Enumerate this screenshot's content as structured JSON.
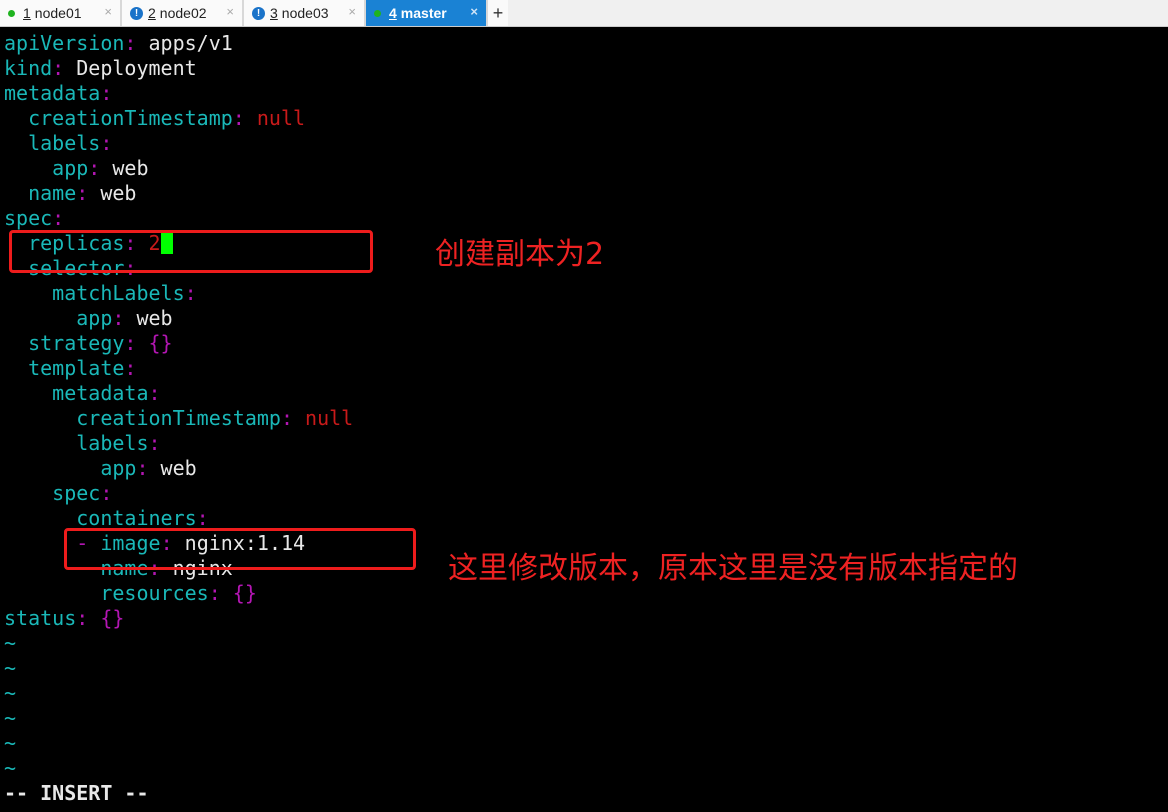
{
  "tabs": [
    {
      "num": "1",
      "label": "node01",
      "status": "connected"
    },
    {
      "num": "2",
      "label": "node02",
      "status": "warning"
    },
    {
      "num": "3",
      "label": "node03",
      "status": "warning"
    },
    {
      "num": "4",
      "label": "master",
      "status": "connected",
      "active": true
    }
  ],
  "new_tab": "+",
  "lines": [
    [
      [
        "k",
        "apiVersion"
      ],
      [
        "c",
        ":"
      ],
      [
        "v",
        " apps/v1"
      ]
    ],
    [
      [
        "k",
        "kind"
      ],
      [
        "c",
        ":"
      ],
      [
        "v",
        " Deployment"
      ]
    ],
    [
      [
        "k",
        "metadata"
      ],
      [
        "c",
        ":"
      ]
    ],
    [
      [
        "v",
        "  "
      ],
      [
        "k",
        "creationTimestamp"
      ],
      [
        "c",
        ":"
      ],
      [
        "n",
        " null"
      ]
    ],
    [
      [
        "v",
        "  "
      ],
      [
        "k",
        "labels"
      ],
      [
        "c",
        ":"
      ]
    ],
    [
      [
        "v",
        "    "
      ],
      [
        "k",
        "app"
      ],
      [
        "c",
        ":"
      ],
      [
        "v",
        " web"
      ]
    ],
    [
      [
        "v",
        "  "
      ],
      [
        "k",
        "name"
      ],
      [
        "c",
        ":"
      ],
      [
        "v",
        " web"
      ]
    ],
    [
      [
        "k",
        "spec"
      ],
      [
        "c",
        ":"
      ]
    ],
    [
      [
        "v",
        "  "
      ],
      [
        "k",
        "replicas"
      ],
      [
        "c",
        ":"
      ],
      [
        "n",
        " 2"
      ],
      [
        "cursor",
        ""
      ]
    ],
    [
      [
        "v",
        "  "
      ],
      [
        "k",
        "selector"
      ],
      [
        "c",
        ":"
      ]
    ],
    [
      [
        "v",
        "    "
      ],
      [
        "k",
        "matchLabels"
      ],
      [
        "c",
        ":"
      ]
    ],
    [
      [
        "v",
        "      "
      ],
      [
        "k",
        "app"
      ],
      [
        "c",
        ":"
      ],
      [
        "v",
        " web"
      ]
    ],
    [
      [
        "v",
        "  "
      ],
      [
        "k",
        "strategy"
      ],
      [
        "c",
        ":"
      ],
      [
        "c",
        " {}"
      ]
    ],
    [
      [
        "v",
        "  "
      ],
      [
        "k",
        "template"
      ],
      [
        "c",
        ":"
      ]
    ],
    [
      [
        "v",
        "    "
      ],
      [
        "k",
        "metadata"
      ],
      [
        "c",
        ":"
      ]
    ],
    [
      [
        "v",
        "      "
      ],
      [
        "k",
        "creationTimestamp"
      ],
      [
        "c",
        ":"
      ],
      [
        "n",
        " null"
      ]
    ],
    [
      [
        "v",
        "      "
      ],
      [
        "k",
        "labels"
      ],
      [
        "c",
        ":"
      ]
    ],
    [
      [
        "v",
        "        "
      ],
      [
        "k",
        "app"
      ],
      [
        "c",
        ":"
      ],
      [
        "v",
        " web"
      ]
    ],
    [
      [
        "v",
        "    "
      ],
      [
        "k",
        "spec"
      ],
      [
        "c",
        ":"
      ]
    ],
    [
      [
        "v",
        "      "
      ],
      [
        "k",
        "containers"
      ],
      [
        "c",
        ":"
      ]
    ],
    [
      [
        "v",
        "      "
      ],
      [
        "c",
        "- "
      ],
      [
        "k",
        "image"
      ],
      [
        "c",
        ":"
      ],
      [
        "v",
        " nginx:1.14"
      ]
    ],
    [
      [
        "v",
        "        "
      ],
      [
        "k",
        "name"
      ],
      [
        "c",
        ":"
      ],
      [
        "v",
        " nginx"
      ]
    ],
    [
      [
        "v",
        "        "
      ],
      [
        "k",
        "resources"
      ],
      [
        "c",
        ":"
      ],
      [
        "c",
        " {}"
      ]
    ],
    [
      [
        "k",
        "status"
      ],
      [
        "c",
        ":"
      ],
      [
        "c",
        " {}"
      ]
    ],
    [
      [
        "t",
        "~"
      ]
    ],
    [
      [
        "t",
        "~"
      ]
    ],
    [
      [
        "t",
        "~"
      ]
    ],
    [
      [
        "t",
        "~"
      ]
    ],
    [
      [
        "t",
        "~"
      ]
    ],
    [
      [
        "t",
        "~"
      ]
    ],
    [
      [
        "b",
        "-- INSERT --"
      ]
    ]
  ],
  "annotations": {
    "replicas": "创建副本为2",
    "image": "这里修改版本，原本这里是没有版本指定的"
  },
  "colors": {
    "annotation": "#ee1c1c",
    "key": "#1ab8b8",
    "punct": "#b316b3",
    "null": "#c81a1a",
    "cursor": "#00ff00",
    "active_tab": "#1a82d4"
  }
}
